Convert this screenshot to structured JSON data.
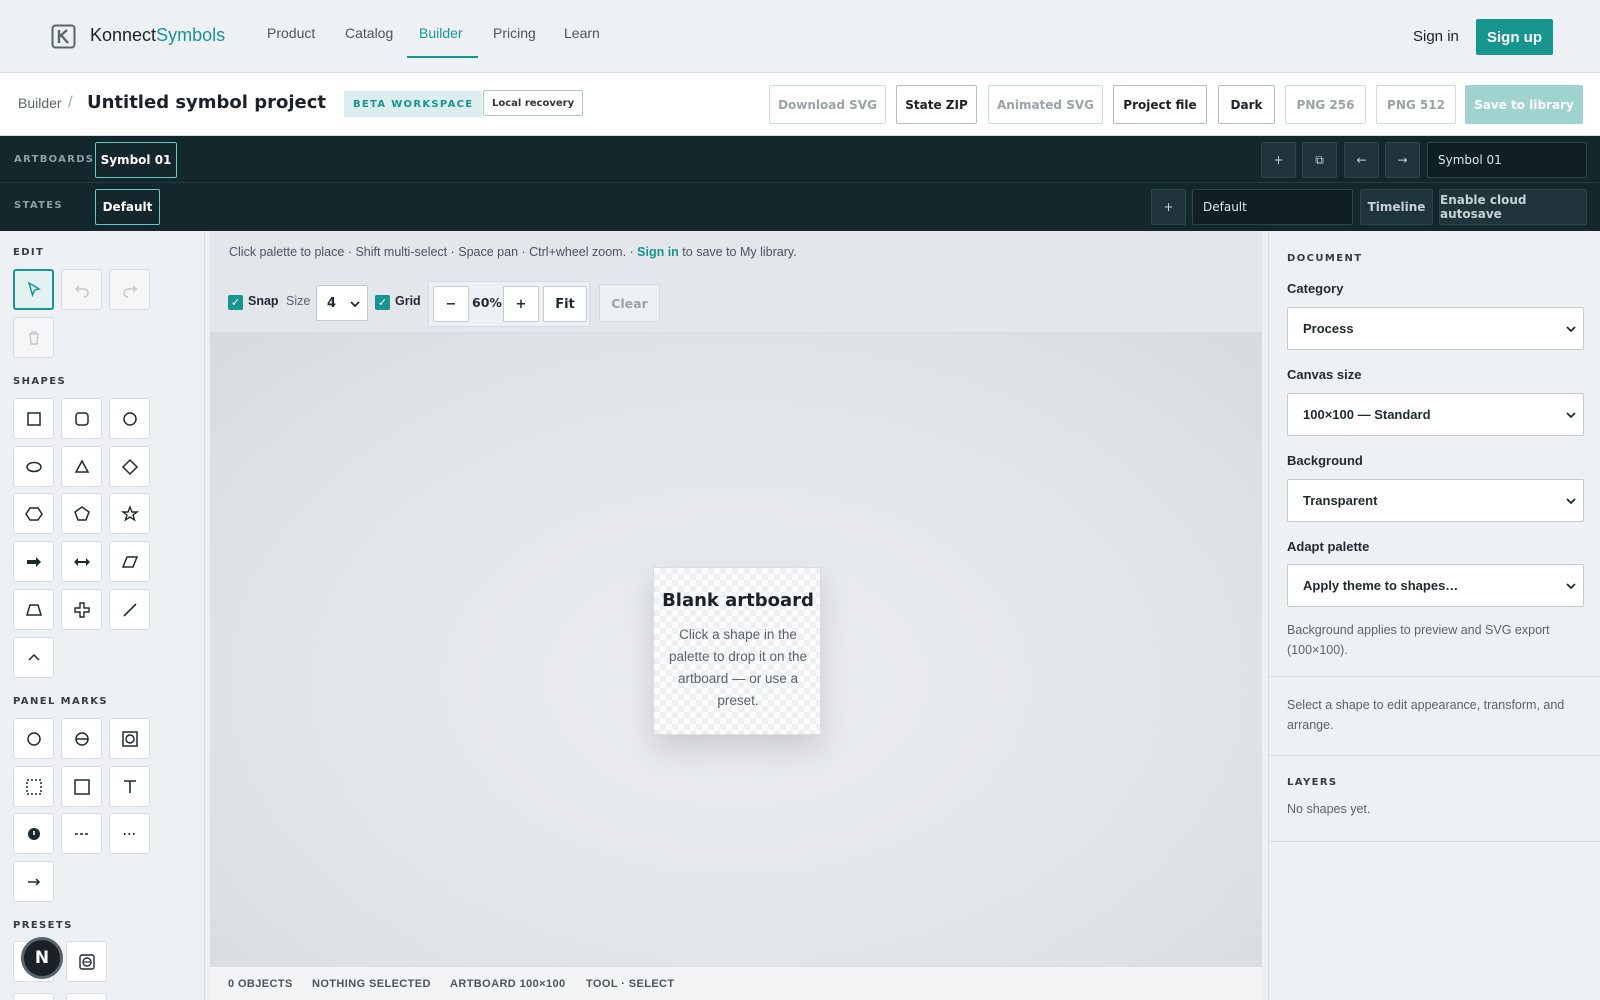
{
  "nav": {
    "brand_a": "Konnect",
    "brand_b": "Symbols",
    "links": [
      "Product",
      "Catalog",
      "Builder",
      "Pricing",
      "Learn"
    ],
    "signin": "Sign in",
    "signup": "Sign up"
  },
  "toolbar": {
    "crumb": "Builder",
    "title": "Untitled symbol project",
    "beta": "BETA WORKSPACE",
    "local": "Local recovery",
    "buttons": [
      "Download SVG",
      "State ZIP",
      "Animated SVG",
      "Project file",
      "Dark",
      "PNG 256",
      "PNG 512",
      "Save to library"
    ]
  },
  "artboards": {
    "label": "ARTBOARDS",
    "active": "Symbol 01",
    "add": "+",
    "dup": "⧉",
    "prev": "←",
    "next": "→",
    "name_value": "Symbol 01"
  },
  "states": {
    "label": "STATES",
    "active": "Default",
    "add": "+",
    "name_value": "Default",
    "timeline": "Timeline",
    "autosave": "Enable cloud autosave"
  },
  "left": {
    "edit": "EDIT",
    "shapes": "SHAPES",
    "panel_marks": "PANEL MARKS",
    "presets": "PRESETS",
    "avatar": "N"
  },
  "canvas": {
    "hint_pre": "Click palette to place · Shift multi-select · Space pan · Ctrl+wheel zoom. · ",
    "hint_link": "Sign in",
    "hint_post": " to save to My library.",
    "snap": "Snap",
    "size_label": "Size",
    "size_value": "4",
    "grid": "Grid",
    "zoom_minus": "−",
    "zoom_value": "60%",
    "zoom_plus": "+",
    "fit": "Fit",
    "clear": "Clear",
    "artboard_title": "Blank artboard",
    "artboard_text": "Click a shape in the palette to drop it on the artboard — or use a preset."
  },
  "status": {
    "objects": "0 OBJECTS",
    "selected": "NOTHING SELECTED",
    "artboard": "ARTBOARD 100×100",
    "tool": "TOOL · SELECT"
  },
  "right": {
    "document": "DOCUMENT",
    "category_label": "Category",
    "category_value": "Process",
    "canvas_label": "Canvas size",
    "canvas_value": "100×100 — Standard",
    "bg_label": "Background",
    "bg_value": "Transparent",
    "palette_label": "Adapt palette",
    "palette_value": "Apply theme to shapes…",
    "bg_note": "Background applies to preview and SVG export (100×100).",
    "select_note": "Select a shape to edit appearance, transform, and arrange.",
    "layers": "LAYERS",
    "layers_empty": "No shapes yet."
  },
  "colors": {
    "accent": "#17958f",
    "dark_bar": "#14272d"
  }
}
